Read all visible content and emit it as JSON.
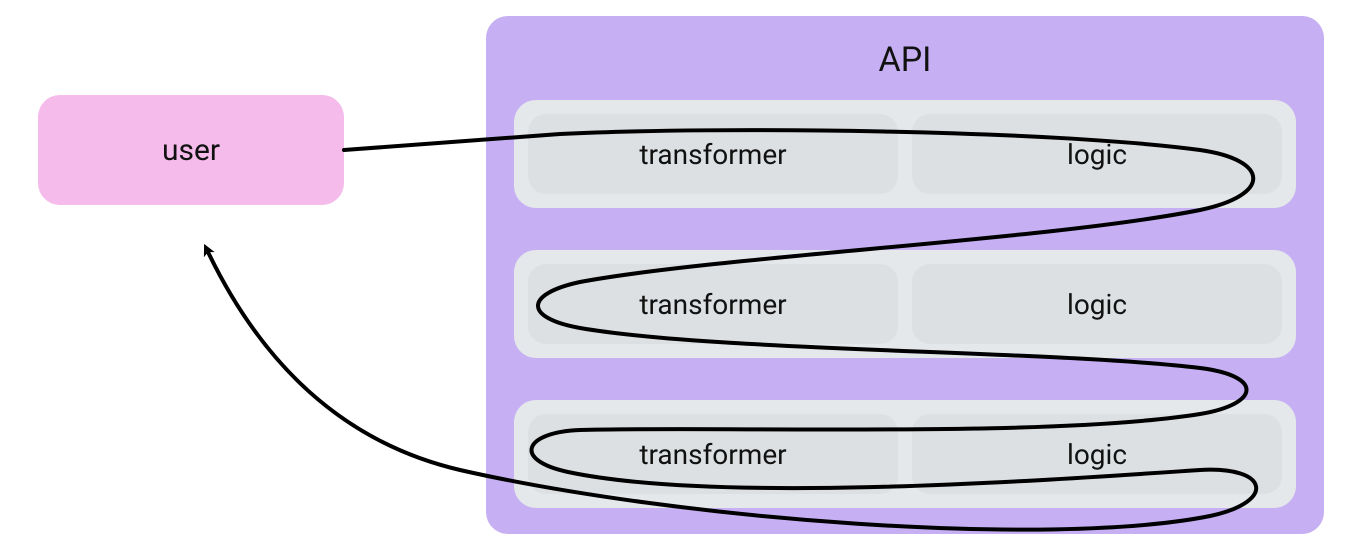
{
  "user": {
    "label": "user"
  },
  "api": {
    "title": "API",
    "rows": [
      {
        "transformer": "transformer",
        "logic": "logic"
      },
      {
        "transformer": "transformer",
        "logic": "logic"
      },
      {
        "transformer": "transformer",
        "logic": "logic"
      }
    ]
  },
  "colors": {
    "user_bg": "#f5bbea",
    "api_bg": "#c6aff3",
    "row_bg": "#e5e8ea",
    "cell_bg": "#dce0e2",
    "stroke": "#000000"
  }
}
